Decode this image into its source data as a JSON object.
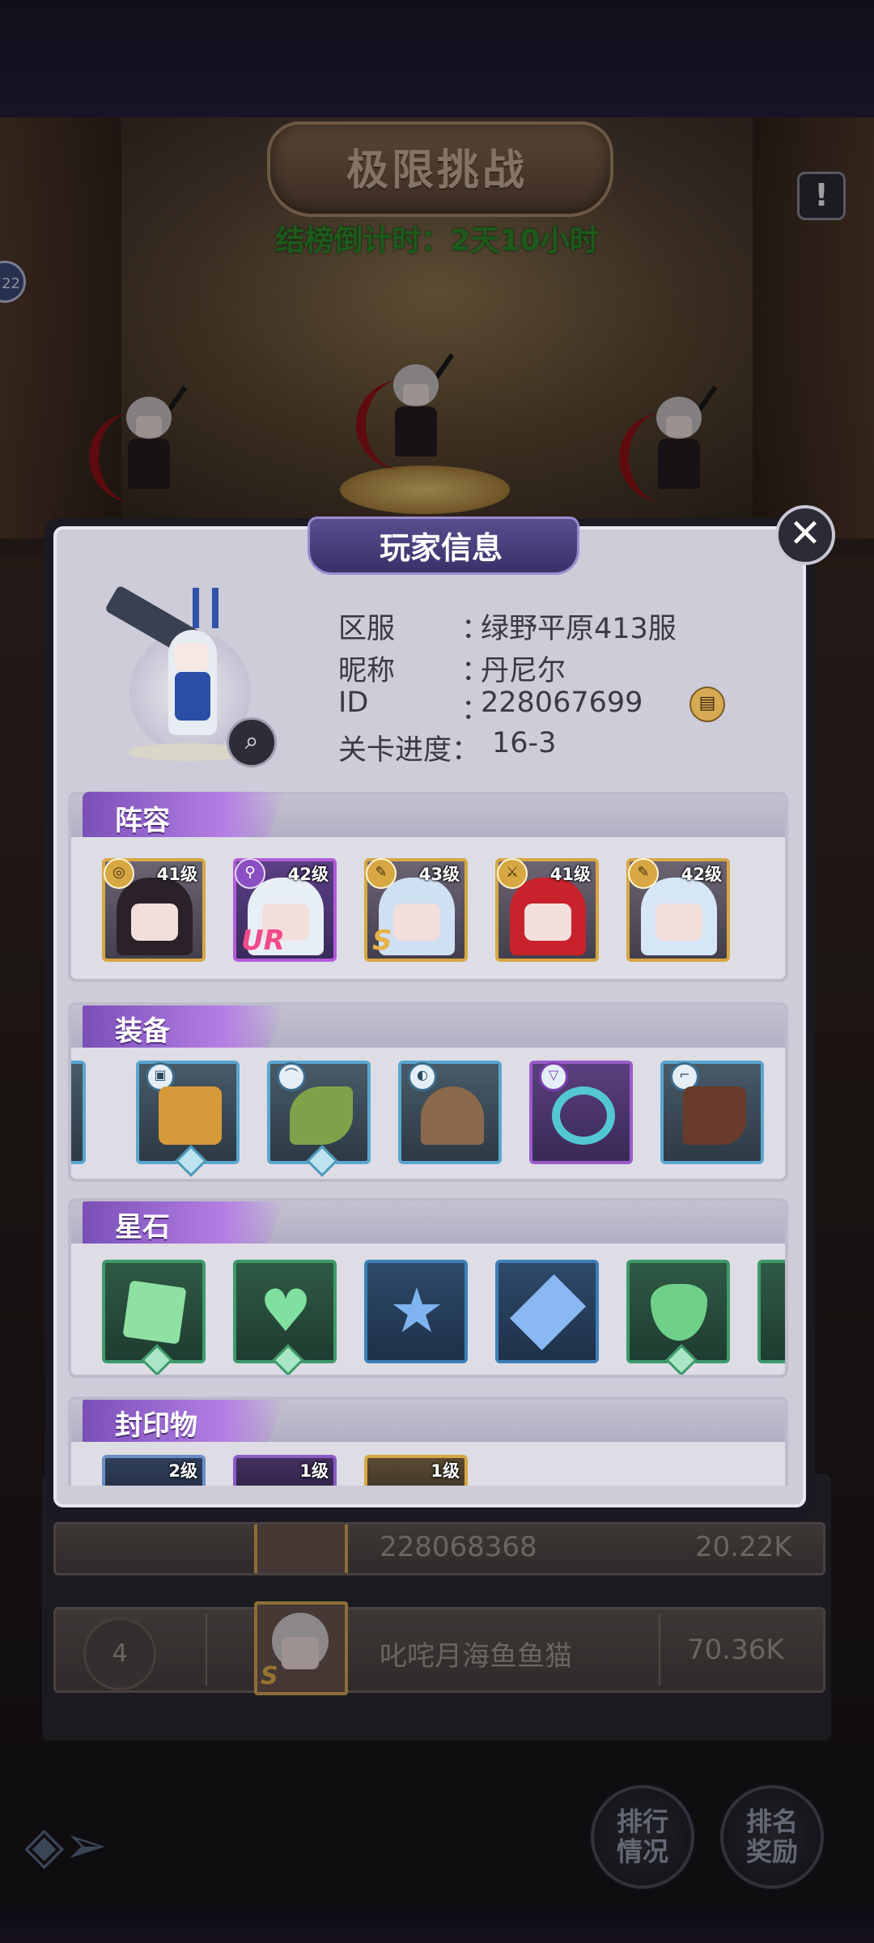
{
  "arena": {
    "title": "极限挑战",
    "countdown": "结榜倒计时：2天10小时",
    "side_badge": "22",
    "alert_icon": "exclamation-icon"
  },
  "dialog": {
    "title": "玩家信息",
    "close_icon": "close-icon"
  },
  "player": {
    "server_label": "区服",
    "server_value": "绿野平原413服",
    "nickname_label": "昵称",
    "nickname_value": "丹尼尔",
    "id_label": "ID",
    "id_value": "228067699",
    "progress_label": "关卡进度：",
    "progress_value": "16-3",
    "colon": "：",
    "copy_icon": "copy-icon",
    "magnifier_icon": "magnifier-icon"
  },
  "lineup": {
    "title": "阵容",
    "heroes": [
      {
        "level": "41级",
        "grade": "",
        "role_icon": "swirl-icon",
        "hair": "#2a2228",
        "frame": "gold"
      },
      {
        "level": "42级",
        "grade": "UR",
        "role_icon": "staff-icon",
        "hair": "#e8eef6",
        "frame": "purple"
      },
      {
        "level": "43级",
        "grade": "S",
        "role_icon": "wrench-icon",
        "hair": "#cfe0f3",
        "frame": "gold"
      },
      {
        "level": "41级",
        "grade": "",
        "role_icon": "sword-icon",
        "hair": "#c8232c",
        "frame": "gold"
      },
      {
        "level": "42级",
        "grade": "",
        "role_icon": "wrench-icon",
        "hair": "#d6e6f6",
        "frame": "gold"
      }
    ]
  },
  "equipment": {
    "title": "装备",
    "items": [
      {
        "name": "book-icon",
        "color": "#d79a3a",
        "frame": "blue"
      },
      {
        "name": "hat-icon",
        "color": "#7ea24a",
        "frame": "blue"
      },
      {
        "name": "cloak-icon",
        "color": "#8a6a4a",
        "frame": "blue"
      },
      {
        "name": "ring-icon",
        "color": "#54c7d4",
        "frame": "purple"
      },
      {
        "name": "boots-icon",
        "color": "#6a3a2a",
        "frame": "blue"
      }
    ]
  },
  "star_stones": {
    "title": "星石",
    "items": [
      {
        "name": "square-gem-icon",
        "color": "#8fe0a3",
        "frame": "green"
      },
      {
        "name": "heart-gem-icon",
        "color": "#7fe0a0",
        "frame": "green"
      },
      {
        "name": "star-gem-icon",
        "color": "#7fb4f0",
        "frame": "blue"
      },
      {
        "name": "crystal-gem-icon",
        "color": "#8ab8f4",
        "frame": "blue"
      },
      {
        "name": "shield-gem-icon",
        "color": "#6fd08a",
        "frame": "green"
      }
    ]
  },
  "seals": {
    "title": "封印物",
    "items": [
      {
        "level": "2级",
        "frame": "blue"
      },
      {
        "level": "1级",
        "frame": "purple"
      },
      {
        "level": "1级",
        "frame": "gold"
      }
    ]
  },
  "leaderboard": {
    "rows": [
      {
        "rank": "4",
        "name": "叱咤月海鱼鱼猫",
        "grade": "S",
        "score": "70.36K"
      }
    ],
    "partial_row": {
      "name": "228068368",
      "score": "20.22K"
    }
  },
  "bottom": {
    "ranking_button": "排行\n情况",
    "reward_button": "排名\n奖励"
  }
}
